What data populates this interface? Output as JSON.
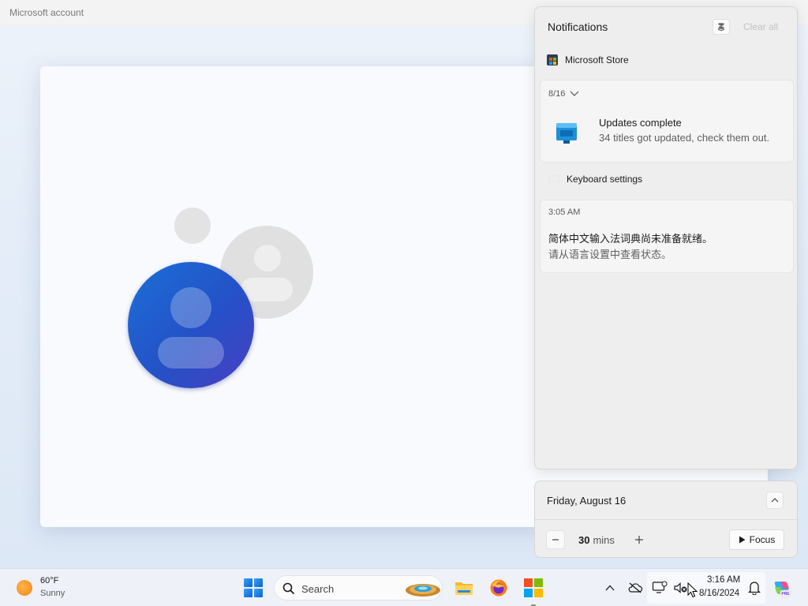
{
  "window": {
    "title": "Microsoft account"
  },
  "notifications": {
    "title": "Notifications",
    "clear_all": "Clear all",
    "group": {
      "app_name": "Microsoft Store"
    },
    "store_notification": {
      "date": "8/16",
      "headline": "Updates complete",
      "body": "34 titles got updated, check them out."
    },
    "keyboard_group": {
      "label": "Keyboard settings"
    },
    "ime_notification": {
      "time": "3:05 AM",
      "line1": "简体中文输入法词典尚未准备就绪。",
      "line2": "请从语言设置中查看状态。"
    }
  },
  "calendar": {
    "date": "Friday, August 16",
    "focus_minutes": "30",
    "focus_unit": "mins",
    "focus_button": "Focus"
  },
  "taskbar": {
    "weather": {
      "temp": "60°F",
      "desc": "Sunny"
    },
    "search_label": "Search",
    "clock": {
      "time": "3:16 AM",
      "date": "8/16/2024"
    }
  },
  "colors": {
    "accent": "#0a63d4",
    "avatar_blue": "#2451c7",
    "panel_bg": "#eeeeee",
    "taskbar_bg": "#eef2f8"
  }
}
